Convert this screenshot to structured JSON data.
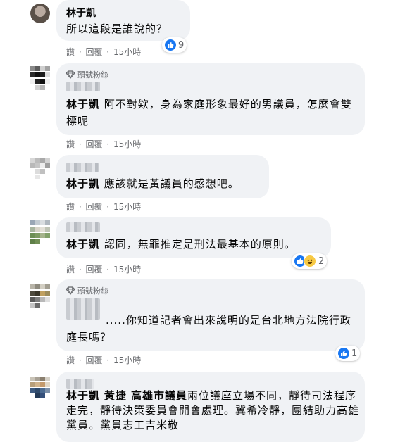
{
  "comments": [
    {
      "author": "林于凱",
      "text": "所以這段是誰說的？",
      "actions": {
        "like": "讚",
        "reply": "回覆",
        "time": "15小時"
      },
      "reactions": {
        "count": "9"
      }
    },
    {
      "badge": "頭號粉絲",
      "mention": "林于凱",
      "text": "阿不對欸，身為家庭形象最好的男議員，怎麼會雙標呢",
      "actions": {
        "like": "讚",
        "reply": "回覆",
        "time": "15小時"
      }
    },
    {
      "mention": "林于凱",
      "text": "應該就是黃議員的感想吧。",
      "actions": {
        "like": "讚",
        "reply": "回覆",
        "time": "15小時"
      }
    },
    {
      "mention": "林于凱",
      "text": "認同，無罪推定是刑法最基本的原則。",
      "actions": {
        "like": "讚",
        "reply": "回覆",
        "time": "15小時"
      },
      "reactions": {
        "count": "2"
      }
    },
    {
      "badge": "頭號粉絲",
      "text": ".....你知道記者會出來說明的是台北地方法院行政庭長嗎？",
      "actions": {
        "like": "讚",
        "reply": "回覆",
        "time": "15小時"
      },
      "reactions": {
        "count": "1"
      }
    },
    {
      "mention": "林于凱",
      "mention2": "黃捷 高雄市議員",
      "text": "兩位議座立場不同，靜待司法程序走完，靜待決策委員會開會處理。冀希冷靜，團結助力高雄黨員。黨員志工吉米敬"
    }
  ],
  "separator": " · ",
  "colors": {
    "bubble": "#f0f2f5",
    "meta": "#65676b",
    "like": "#1877f2"
  }
}
